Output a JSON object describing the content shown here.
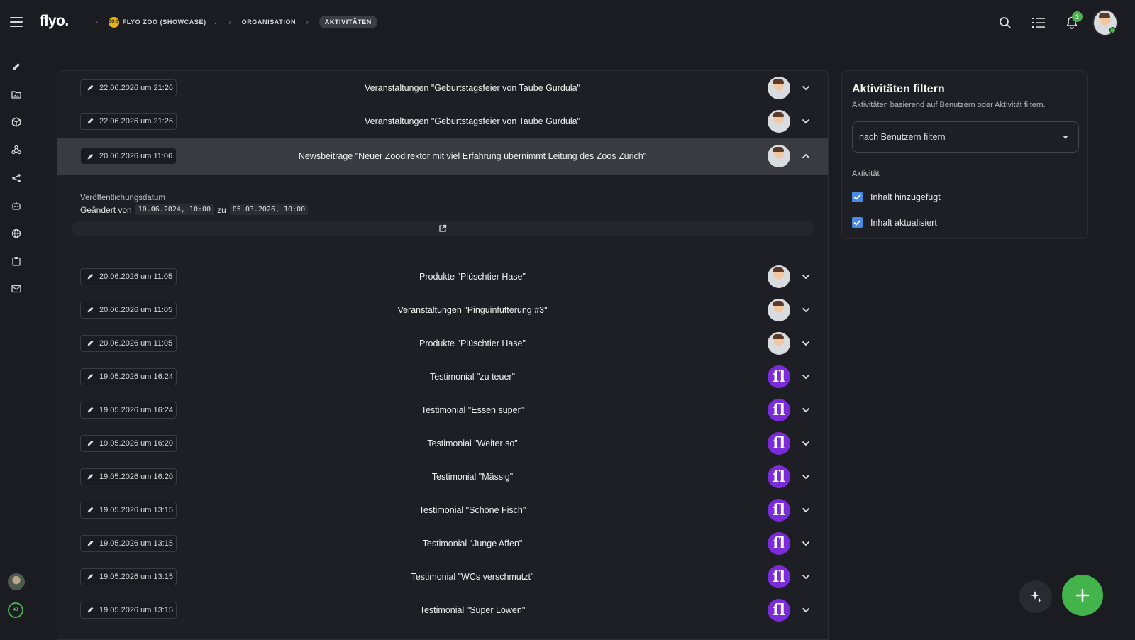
{
  "app": {
    "logo": "flyo."
  },
  "breadcrumbs": {
    "badge": "ZOO",
    "org_select": "FLYO ZOO (SHOWCASE)",
    "section": "ORGANISATION",
    "current": "AKTIVITÄTEN"
  },
  "topbar": {
    "notification_count": "3"
  },
  "rail": {
    "progress_value": "48"
  },
  "activities": [
    {
      "date": "22.06.2026 um 21:26",
      "title": "Veranstaltungen \"Geburtstagsfeier von Taube Gurdula\"",
      "user": "photo"
    },
    {
      "date": "22.06.2026 um 21:26",
      "title": "Veranstaltungen \"Geburtstagsfeier von Taube Gurdula\"",
      "user": "photo"
    },
    {
      "date": "20.06.2026 um 11:06",
      "title": "Newsbeiträge \"Neuer Zoodirektor mit viel Erfahrung übernimmt Leitung des Zoos Zürich\"",
      "user": "photo",
      "expanded": true
    },
    {
      "date": "20.06.2026 um 11:05",
      "title": "Produkte \"Plüschtier Hase\"",
      "user": "photo"
    },
    {
      "date": "20.06.2026 um 11:05",
      "title": "Veranstaltungen \"Pinguinfütterung #3\"",
      "user": "photo"
    },
    {
      "date": "20.06.2026 um 11:05",
      "title": "Produkte \"Plüschtier Hase\"",
      "user": "photo"
    },
    {
      "date": "19.05.2026 um 16:24",
      "title": "Testimonial \"zu teuer\"",
      "user": "flyo"
    },
    {
      "date": "19.05.2026 um 16:24",
      "title": "Testimonial \"Essen super\"",
      "user": "flyo"
    },
    {
      "date": "19.05.2026 um 16:20",
      "title": "Testimonial \"Weiter so\"",
      "user": "flyo"
    },
    {
      "date": "19.05.2026 um 16:20",
      "title": "Testimonial \"Mässig\"",
      "user": "flyo"
    },
    {
      "date": "19.05.2026 um 13:15",
      "title": "Testimonial \"Schöne Fisch\"",
      "user": "flyo"
    },
    {
      "date": "19.05.2026 um 13:15",
      "title": "Testimonial \"Junge Affen\"",
      "user": "flyo"
    },
    {
      "date": "19.05.2026 um 13:15",
      "title": "Testimonial \"WCs verschmutzt\"",
      "user": "flyo"
    },
    {
      "date": "19.05.2026 um 13:15",
      "title": "Testimonial \"Super Löwen\"",
      "user": "flyo"
    }
  ],
  "detail": {
    "label": "Veröffentlichungsdatum",
    "changed_from_text": "Geändert von",
    "old_value": "10.06.2024, 10:00",
    "to_text": "zu",
    "new_value": "05.03.2026, 10:00"
  },
  "filter": {
    "title": "Aktivitäten filtern",
    "subtitle": "Aktivitäten basierend auf Benutzern oder Aktivität filtern.",
    "user_select_placeholder": "nach Benutzern filtern",
    "section_label": "Aktivität",
    "options": [
      {
        "label": "Inhalt hinzugefügt",
        "checked": true
      },
      {
        "label": "Inhalt aktualisiert",
        "checked": true
      }
    ]
  },
  "colors": {
    "accent_green": "#43b34c",
    "checkbox_blue": "#4a8ae0",
    "flyo_purple": "#7b2bd9"
  }
}
